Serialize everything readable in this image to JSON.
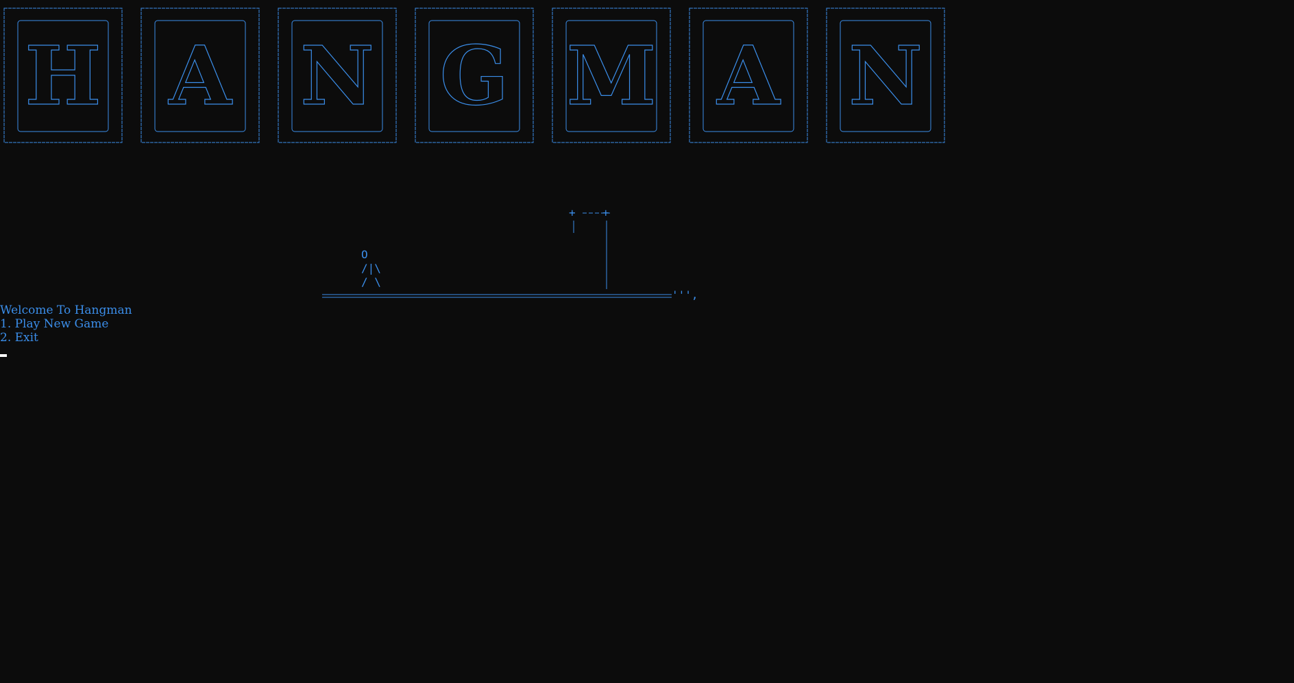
{
  "terminal": {
    "banner_letters": [
      "H",
      "A",
      "N",
      "G",
      "M",
      "A",
      "N"
    ],
    "figure": {
      "head": "O",
      "body": "/|\\",
      "legs": "/ \\"
    },
    "ground_suffix": "''',",
    "menu": {
      "title": "Welcome To Hangman",
      "option_1": "1. Play New Game",
      "option_2": "2. Exit"
    },
    "colors": {
      "background": "#0c0c0c",
      "text": "#3b8eea",
      "cursor": "#ffffff"
    }
  }
}
